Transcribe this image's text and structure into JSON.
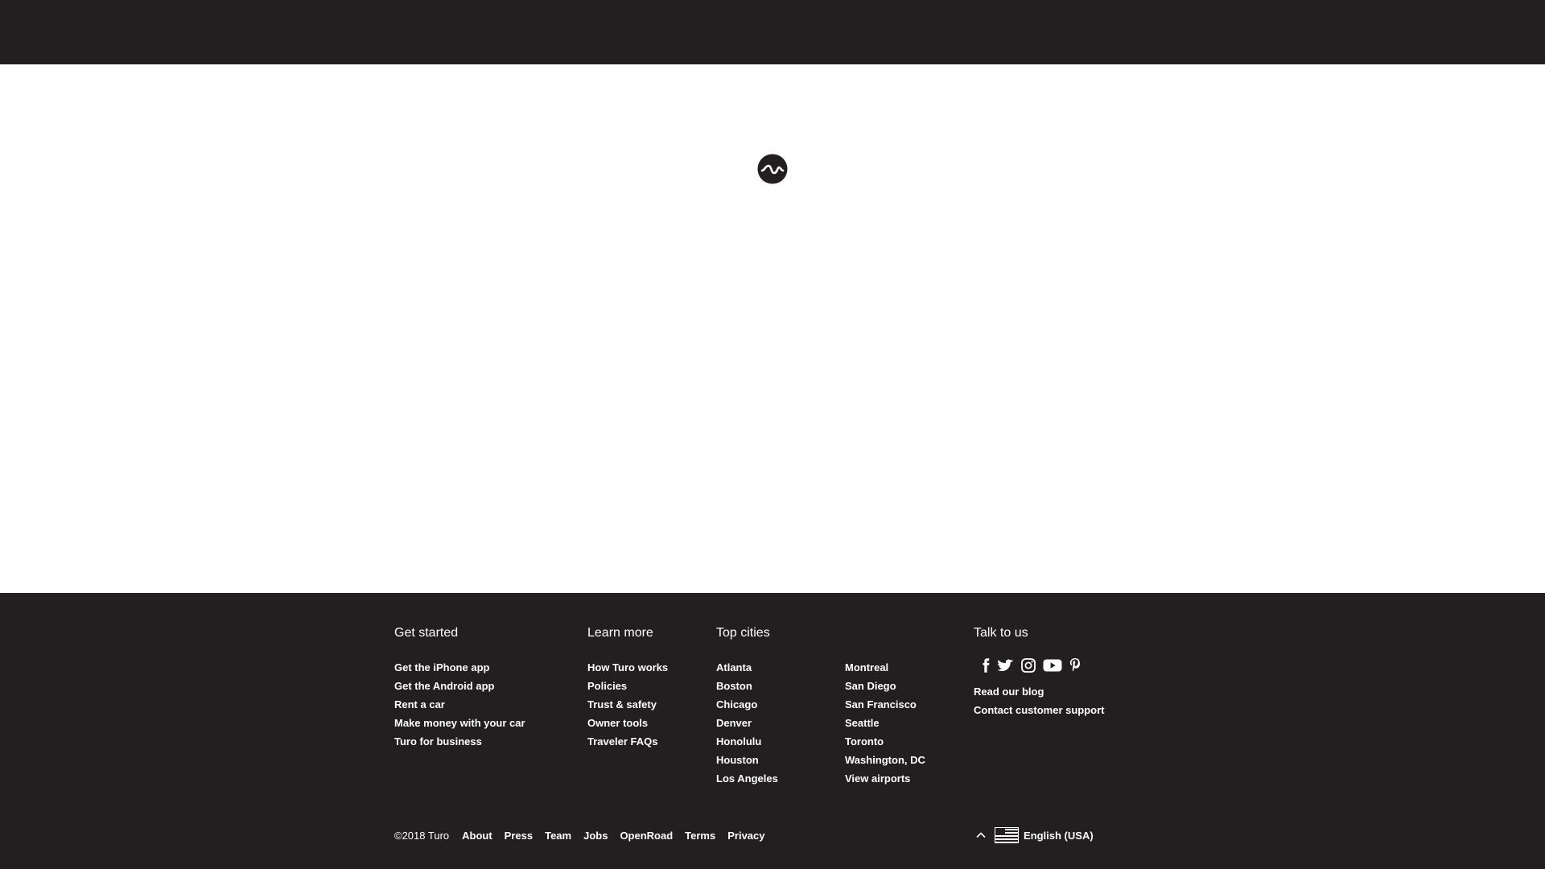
{
  "footer": {
    "columns": {
      "get_started": {
        "title": "Get started",
        "links": [
          "Get the iPhone app",
          "Get the Android app",
          "Rent a car",
          "Make money with your car",
          "Turo for business"
        ]
      },
      "learn_more": {
        "title": "Learn more",
        "links": [
          "How Turo works",
          "Policies",
          "Trust & safety",
          "Owner tools",
          "Traveler FAQs"
        ]
      },
      "top_cities": {
        "title": "Top cities",
        "links_col1": [
          "Atlanta",
          "Boston",
          "Chicago",
          "Denver",
          "Honolulu",
          "Houston",
          "Los Angeles"
        ],
        "links_col2": [
          "Montreal",
          "San Diego",
          "San Francisco",
          "Seattle",
          "Toronto",
          "Washington, DC",
          "View airports"
        ]
      },
      "talk_to_us": {
        "title": "Talk to us",
        "social_icons": [
          "facebook-icon",
          "twitter-icon",
          "instagram-icon",
          "youtube-icon",
          "pinterest-icon"
        ],
        "links": [
          "Read our blog",
          "Contact customer support"
        ]
      }
    },
    "bottom": {
      "copyright": "©2018 Turo",
      "links": [
        "About",
        "Press",
        "Team",
        "Jobs",
        "OpenRoad",
        "Terms",
        "Privacy"
      ]
    },
    "language": {
      "label": "English (USA)",
      "flag_icon": "us-flag-icon",
      "caret_icon": "chevron-up-icon"
    }
  },
  "colors": {
    "dark_background": "#231f20",
    "page_background": "#ffffff",
    "text_light": "#ffffff"
  },
  "main": {
    "loading_icon": "turo-logo-spinner-icon"
  }
}
